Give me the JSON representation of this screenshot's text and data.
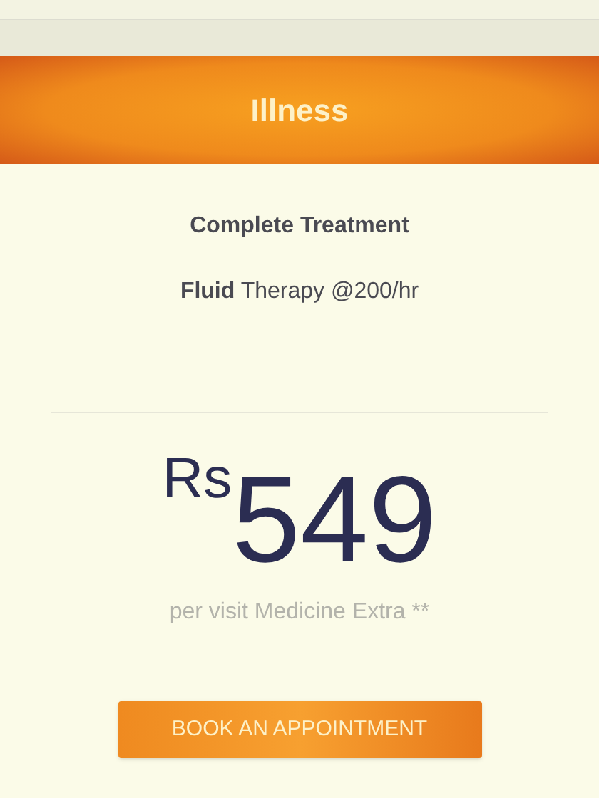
{
  "plan": {
    "title": "Illness",
    "features": [
      "Complete Treatment",
      "**Fluid** Therapy @200/hr"
    ],
    "price": {
      "currency": "Rs",
      "amount": "549",
      "note": "per visit Medicine Extra **"
    },
    "button": "BOOK AN APPOINTMENT"
  }
}
